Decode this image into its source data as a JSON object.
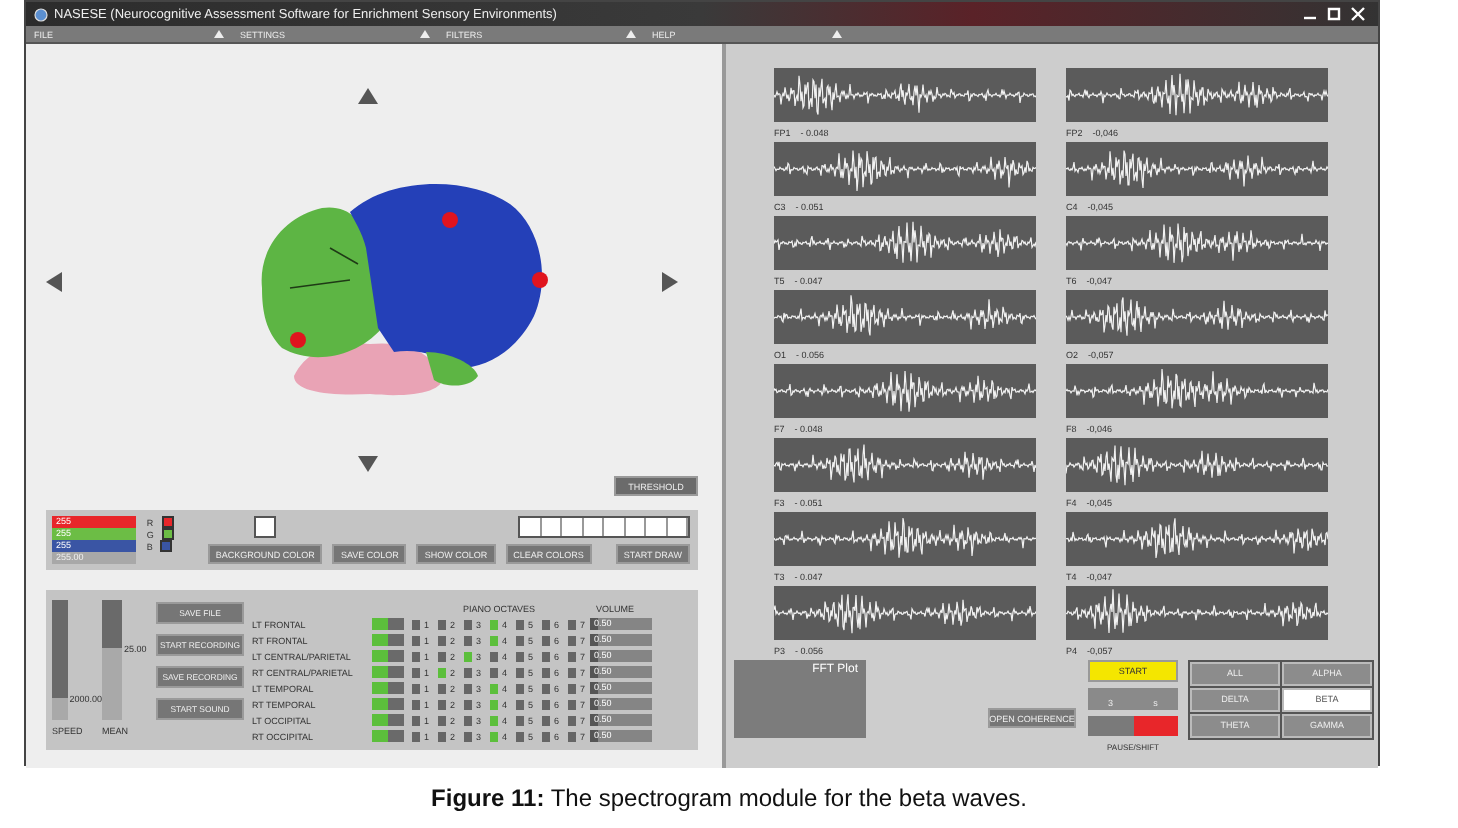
{
  "window": {
    "title": "NASESE (Neurocognitive Assessment Software for Enrichment Sensory Environments)"
  },
  "menu": [
    "FILE",
    "SETTINGS",
    "FILTERS",
    "HELP"
  ],
  "brain_view": {
    "threshold_button": "THRESHOLD"
  },
  "color_panel": {
    "sliders": [
      {
        "channel": "R",
        "value": "255",
        "level": 1,
        "color": "#e8262a"
      },
      {
        "channel": "G",
        "value": "255",
        "level": 1,
        "color": "#6cbd45"
      },
      {
        "channel": "B",
        "value": "255",
        "level": 1,
        "color": "#3a55a4"
      }
    ],
    "output": "255.00",
    "buttons": [
      "BACKGROUND COLOR",
      "SAVE COLOR",
      "SHOW COLOR",
      "CLEAR COLORS",
      "START DRAW"
    ]
  },
  "sliders": [
    {
      "label": "SPEED",
      "reading": "2000.00",
      "level": 0.18
    },
    {
      "label": "MEAN",
      "reading": "25.00",
      "level": 0.6
    }
  ],
  "file_buttons": [
    "SAVE FILE",
    "START RECORDING",
    "SAVE RECORDING",
    "START SOUND"
  ],
  "regions": {
    "octaves_title": "PIANO OCTAVES",
    "volume_title": "VOLUME",
    "rows": [
      {
        "name": "LT FRONTAL",
        "level": 0.5,
        "volume": {
          "reading": "0.50",
          "level": 0.12
        },
        "octaves": [
          {
            "label": "1",
            "selected": false
          },
          {
            "label": "2",
            "selected": false
          },
          {
            "label": "3",
            "selected": false
          },
          {
            "label": "4",
            "selected": true
          },
          {
            "label": "5",
            "selected": false
          },
          {
            "label": "6",
            "selected": false
          },
          {
            "label": "7",
            "selected": false
          }
        ]
      },
      {
        "name": "RT FRONTAL",
        "level": 0.5,
        "volume": {
          "reading": "0.50",
          "level": 0.12
        },
        "octaves": [
          {
            "label": "1",
            "selected": false
          },
          {
            "label": "2",
            "selected": false
          },
          {
            "label": "3",
            "selected": false
          },
          {
            "label": "4",
            "selected": true
          },
          {
            "label": "5",
            "selected": false
          },
          {
            "label": "6",
            "selected": false
          },
          {
            "label": "7",
            "selected": false
          }
        ]
      },
      {
        "name": "LT CENTRAL/PARIETAL",
        "level": 0.5,
        "volume": {
          "reading": "0.50",
          "level": 0.12
        },
        "octaves": [
          {
            "label": "1",
            "selected": false
          },
          {
            "label": "2",
            "selected": false
          },
          {
            "label": "3",
            "selected": true
          },
          {
            "label": "4",
            "selected": false
          },
          {
            "label": "5",
            "selected": false
          },
          {
            "label": "6",
            "selected": false
          },
          {
            "label": "7",
            "selected": false
          }
        ]
      },
      {
        "name": "RT CENTRAL/PARIETAL",
        "level": 0.5,
        "volume": {
          "reading": "0.50",
          "level": 0.12
        },
        "octaves": [
          {
            "label": "1",
            "selected": false
          },
          {
            "label": "2",
            "selected": true
          },
          {
            "label": "3",
            "selected": false
          },
          {
            "label": "4",
            "selected": false
          },
          {
            "label": "5",
            "selected": false
          },
          {
            "label": "6",
            "selected": false
          },
          {
            "label": "7",
            "selected": false
          }
        ]
      },
      {
        "name": "LT TEMPORAL",
        "level": 0.5,
        "volume": {
          "reading": "0.50",
          "level": 0.12
        },
        "octaves": [
          {
            "label": "1",
            "selected": false
          },
          {
            "label": "2",
            "selected": false
          },
          {
            "label": "3",
            "selected": false
          },
          {
            "label": "4",
            "selected": true
          },
          {
            "label": "5",
            "selected": false
          },
          {
            "label": "6",
            "selected": false
          },
          {
            "label": "7",
            "selected": false
          }
        ]
      },
      {
        "name": "RT TEMPORAL",
        "level": 0.5,
        "volume": {
          "reading": "0.50",
          "level": 0.12
        },
        "octaves": [
          {
            "label": "1",
            "selected": false
          },
          {
            "label": "2",
            "selected": false
          },
          {
            "label": "3",
            "selected": false
          },
          {
            "label": "4",
            "selected": true
          },
          {
            "label": "5",
            "selected": false
          },
          {
            "label": "6",
            "selected": false
          },
          {
            "label": "7",
            "selected": false
          }
        ]
      },
      {
        "name": "LT OCCIPITAL",
        "level": 0.5,
        "volume": {
          "reading": "0.50",
          "level": 0.12
        },
        "octaves": [
          {
            "label": "1",
            "selected": false
          },
          {
            "label": "2",
            "selected": false
          },
          {
            "label": "3",
            "selected": false
          },
          {
            "label": "4",
            "selected": true
          },
          {
            "label": "5",
            "selected": false
          },
          {
            "label": "6",
            "selected": false
          },
          {
            "label": "7",
            "selected": false
          }
        ]
      },
      {
        "name": "RT OCCIPITAL",
        "level": 0.5,
        "volume": {
          "reading": "0.50",
          "level": 0.12
        },
        "octaves": [
          {
            "label": "1",
            "selected": false
          },
          {
            "label": "2",
            "selected": false
          },
          {
            "label": "3",
            "selected": false
          },
          {
            "label": "4",
            "selected": true
          },
          {
            "label": "5",
            "selected": false
          },
          {
            "label": "6",
            "selected": false
          },
          {
            "label": "7",
            "selected": false
          }
        ]
      }
    ]
  },
  "channels": [
    {
      "name": "FP1",
      "reading": "- 0.048"
    },
    {
      "name": "FP2",
      "reading": "-0,046"
    },
    {
      "name": "C3",
      "reading": "- 0.051"
    },
    {
      "name": "C4",
      "reading": "-0,045"
    },
    {
      "name": "T5",
      "reading": "- 0.047"
    },
    {
      "name": "T6",
      "reading": "-0,047"
    },
    {
      "name": "O1",
      "reading": "- 0.056"
    },
    {
      "name": "O2",
      "reading": "-0,057"
    },
    {
      "name": "F7",
      "reading": "- 0.048"
    },
    {
      "name": "F8",
      "reading": "-0,046"
    },
    {
      "name": "F3",
      "reading": "- 0.051"
    },
    {
      "name": "F4",
      "reading": "-0,045"
    },
    {
      "name": "T3",
      "reading": "- 0.047"
    },
    {
      "name": "T4",
      "reading": "-0,047"
    },
    {
      "name": "P3",
      "reading": "- 0.056"
    },
    {
      "name": "P4",
      "reading": "-0,057"
    }
  ],
  "fft_plot": {
    "title": "FFT Plot"
  },
  "coherence_button": "OPEN COHERENCE",
  "start_button": "START",
  "timer": {
    "value": "3",
    "unit": "s"
  },
  "status_light": {
    "on": true,
    "label": "PAUSE/SHIFT"
  },
  "bands": [
    {
      "label": "ALL",
      "selected": false
    },
    {
      "label": "ALPHA",
      "selected": false
    },
    {
      "label": "DELTA",
      "selected": false
    },
    {
      "label": "BETA",
      "selected": true
    },
    {
      "label": "THETA",
      "selected": false
    },
    {
      "label": "GAMMA",
      "selected": false
    }
  ],
  "caption": "**Figure 11:** The spectrogram module for the beta waves."
}
